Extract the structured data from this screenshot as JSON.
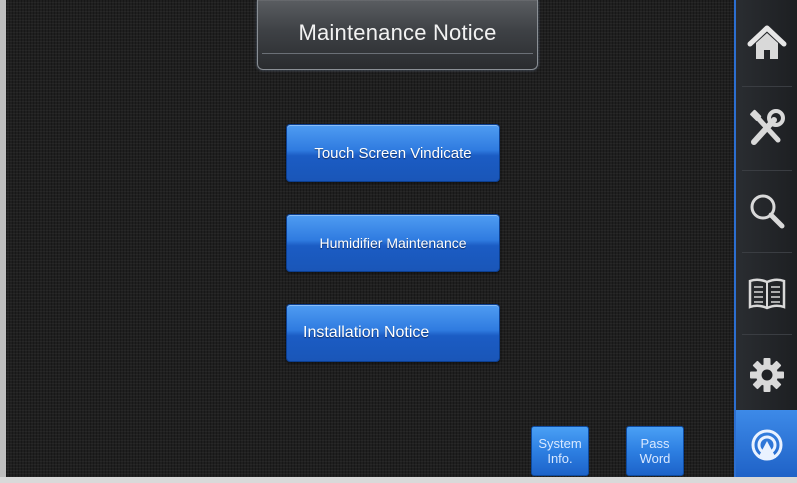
{
  "header": {
    "title": "Maintenance Notice"
  },
  "menu": {
    "buttons": [
      {
        "label": "Touch Screen Vindicate"
      },
      {
        "label": "Humidifier Maintenance"
      },
      {
        "label": "Installation Notice"
      }
    ]
  },
  "footer": {
    "system_info": {
      "line1": "System",
      "line2": "Info."
    },
    "pass_word": {
      "line1": "Pass",
      "line2": "Word"
    }
  },
  "sidebar": {
    "items": [
      {
        "icon": "home-icon",
        "active": false
      },
      {
        "icon": "tools-icon",
        "active": false
      },
      {
        "icon": "search-icon",
        "active": false
      },
      {
        "icon": "book-icon",
        "active": false
      },
      {
        "icon": "gear-icon",
        "active": false
      },
      {
        "icon": "maintenance-icon",
        "active": true
      }
    ]
  },
  "colors": {
    "background": "#1f1f1f",
    "button_blue": "#2f7be0",
    "sidebar_accent": "#2c6fd1",
    "title_panel": "#3e4145"
  }
}
